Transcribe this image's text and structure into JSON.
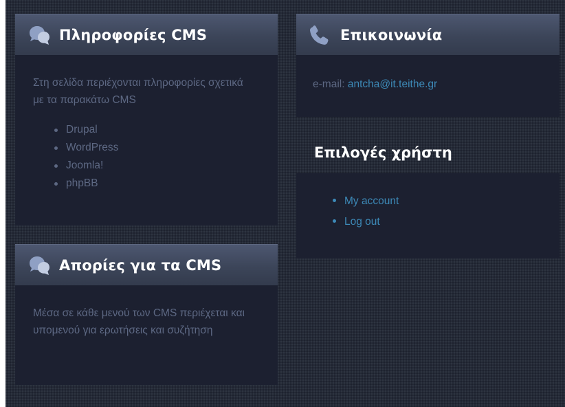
{
  "cms_info": {
    "title": "Πληροφορίες CMS",
    "icon": "chat-bubbles-icon",
    "description": "Στη σελίδα περιέχονται πληροφορίες σχετικά με τα παρακάτω CMS",
    "items": [
      "Drupal",
      "WordPress",
      "Joomla!",
      "phpBB"
    ]
  },
  "cms_questions": {
    "title": "Απορίες για τα CMS",
    "icon": "chat-bubbles-icon",
    "description": "Μέσα σε κάθε μενού των CMS περιέχεται και υπομενού για ερωτήσεις και συζήτηση"
  },
  "contact": {
    "title": "Επικοινωνία",
    "icon": "phone-icon",
    "email_label": "e-mail:",
    "email": "antcha@it.teithe.gr"
  },
  "user_options": {
    "title": "Επιλογές χρήστη",
    "links": [
      "My account",
      "Log out"
    ]
  },
  "colors": {
    "background": "#242a37",
    "panel": "#1c2030",
    "header": "#3c4559",
    "muted_text": "#5d6883",
    "link": "#3d8ab8"
  }
}
